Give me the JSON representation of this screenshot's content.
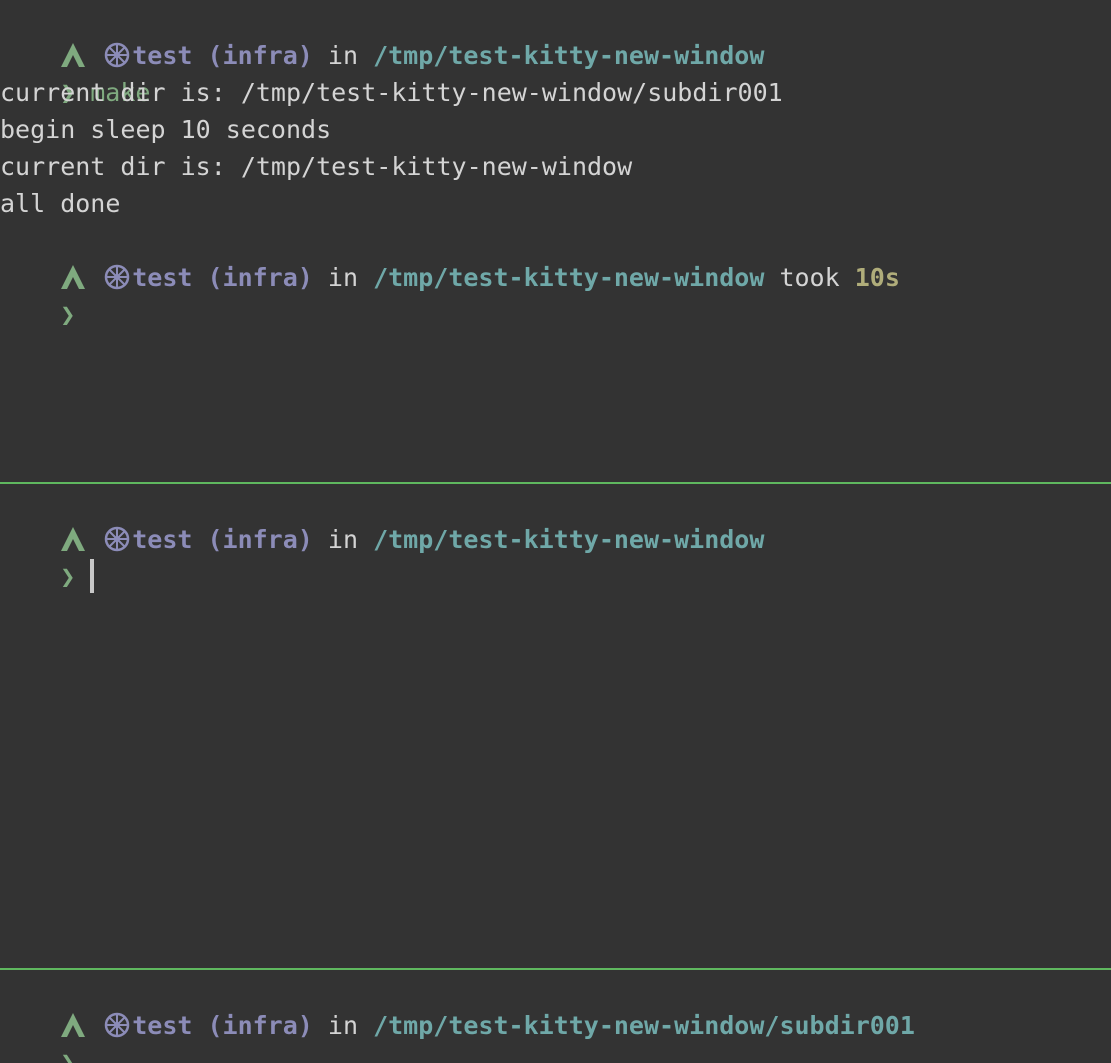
{
  "colors": {
    "background": "#333333",
    "divider": "#5fb85f",
    "context": "#8c8cb8",
    "path": "#6fa8a8",
    "prompt": "#7faa7f",
    "duration": "#b0ad7a",
    "text": "#d4d4d4"
  },
  "icons": {
    "os": "arch-linux-icon",
    "kube": "kubernetes-icon",
    "prompt": "chevron-right-prompt"
  },
  "prompt_symbol": "❯",
  "panes": [
    {
      "header": {
        "context": "test (infra)",
        "in": " in ",
        "path": "/tmp/test-kitty-new-window"
      },
      "command": "make",
      "output": [
        "current dir is: /tmp/test-kitty-new-window/subdir001",
        "begin sleep 10 seconds",
        "current dir is: /tmp/test-kitty-new-window",
        "all done"
      ],
      "header2": {
        "context": "test (infra)",
        "in": " in ",
        "path": "/tmp/test-kitty-new-window",
        "took": " took ",
        "duration": "10s"
      }
    },
    {
      "header": {
        "context": "test (infra)",
        "in": " in ",
        "path": "/tmp/test-kitty-new-window"
      }
    },
    {
      "header": {
        "context": "test (infra)",
        "in": " in ",
        "path": "/tmp/test-kitty-new-window/subdir001"
      }
    }
  ]
}
